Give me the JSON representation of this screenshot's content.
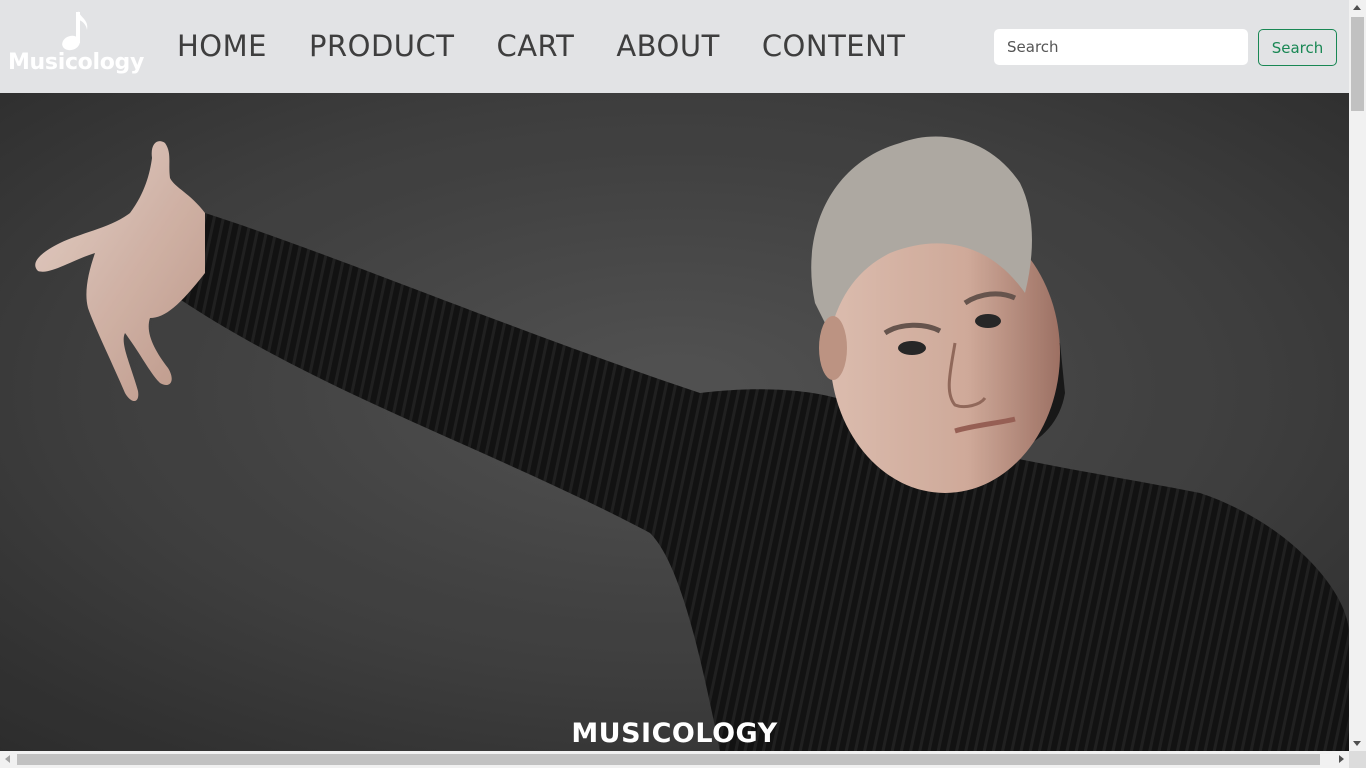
{
  "navbar": {
    "brand": {
      "name": "Musicology",
      "icon": "music-note-icon"
    },
    "links": [
      {
        "label": "HOME"
      },
      {
        "label": "PRODUCT"
      },
      {
        "label": "CART"
      },
      {
        "label": "ABOUT"
      },
      {
        "label": "CONTENT"
      }
    ],
    "search": {
      "placeholder": "Search",
      "button_label": "Search"
    }
  },
  "hero": {
    "image": "dancer-in-black-turtleneck-photo",
    "caption": "MUSICOLOGY"
  },
  "colors": {
    "navbar_bg": "#e2e3e5",
    "nav_text": "#3e3e3e",
    "search_button": "#198754",
    "caption_text": "#ffffff"
  }
}
